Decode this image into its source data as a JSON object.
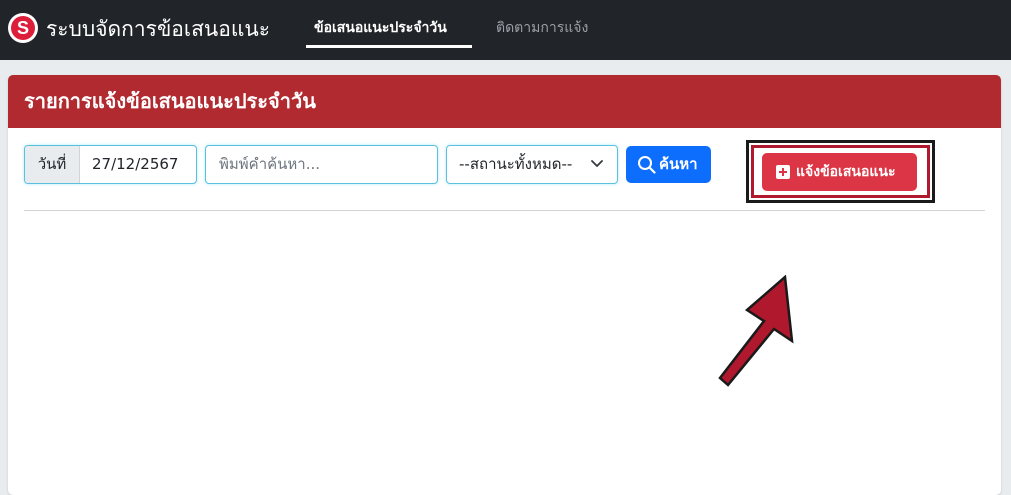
{
  "navbar": {
    "logo_letter": "S",
    "brand": "ระบบจัดการข้อเสนอแนะ",
    "links": [
      {
        "label": "ข้อเสนอแนะประจำวัน",
        "active": true
      },
      {
        "label": "ติดตามการแจ้ง",
        "active": false
      }
    ]
  },
  "card": {
    "title": "รายการแจ้งข้อเสนอแนะประจำวัน",
    "header_color": "#b02a30"
  },
  "filters": {
    "date_label": "วันที่",
    "date_value": "27/12/2567",
    "search_placeholder": "พิมพ์คำค้นหา...",
    "status_selected": "--สถานะทั้งหมด--",
    "search_button": "ค้นหา",
    "search_icon": "search-icon",
    "chevron_icon": "chevron-down-icon"
  },
  "actions": {
    "report_button": "แจ้งข้อเสนอแนะ",
    "report_icon": "plus-square-icon",
    "report_color": "#dc3545"
  },
  "annotation": {
    "arrow_color": "#b0182e",
    "highlight_color": "#b0182e"
  }
}
